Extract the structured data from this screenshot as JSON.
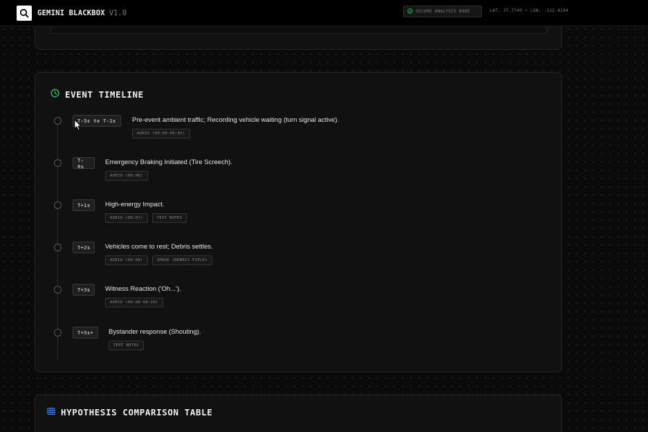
{
  "header": {
    "brand": "GEMINI BLACKBOX",
    "version": "V1.0",
    "status": "SECURE ANALYSIS NODE",
    "coords": "LAT: 37.7749 • LON: -122.4194"
  },
  "timeline": {
    "title": "EVENT TIMELINE",
    "events": [
      {
        "time": "T-5s to T-1s",
        "desc": "Pre-event ambient traffic; Recording vehicle waiting (turn signal active).",
        "tags": [
          "AUDIO (00:00-00:05)"
        ]
      },
      {
        "time": "T-0s",
        "desc": "Emergency Braking Initiated (Tire Screech).",
        "tags": [
          "AUDIO (00:06)"
        ]
      },
      {
        "time": "T+1s",
        "desc": "High-energy Impact.",
        "tags": [
          "AUDIO (00:07)",
          "TEXT NOTES"
        ]
      },
      {
        "time": "T+2s",
        "desc": "Vehicles come to rest; Debris settles.",
        "tags": [
          "AUDIO (00:08)",
          "IMAGE (DEBRIS FIELD)"
        ]
      },
      {
        "time": "T+3s",
        "desc": "Witness Reaction ('Oh...').",
        "tags": [
          "AUDIO (00:08-00:10)"
        ]
      },
      {
        "time": "T+5s+",
        "desc": "Bystander response (Shouting).",
        "tags": [
          "TEXT NOTES"
        ]
      }
    ]
  },
  "hypothesis": {
    "title": "HYPOTHESIS COMPARISON TABLE"
  },
  "colors": {
    "accent_green": "#22c55e",
    "accent_blue": "#3b82f6",
    "background": "#0a0a0a"
  },
  "icons": {
    "logo": "search-icon",
    "status": "shield-check-icon",
    "timeline": "clock-icon",
    "table": "table-icon"
  }
}
